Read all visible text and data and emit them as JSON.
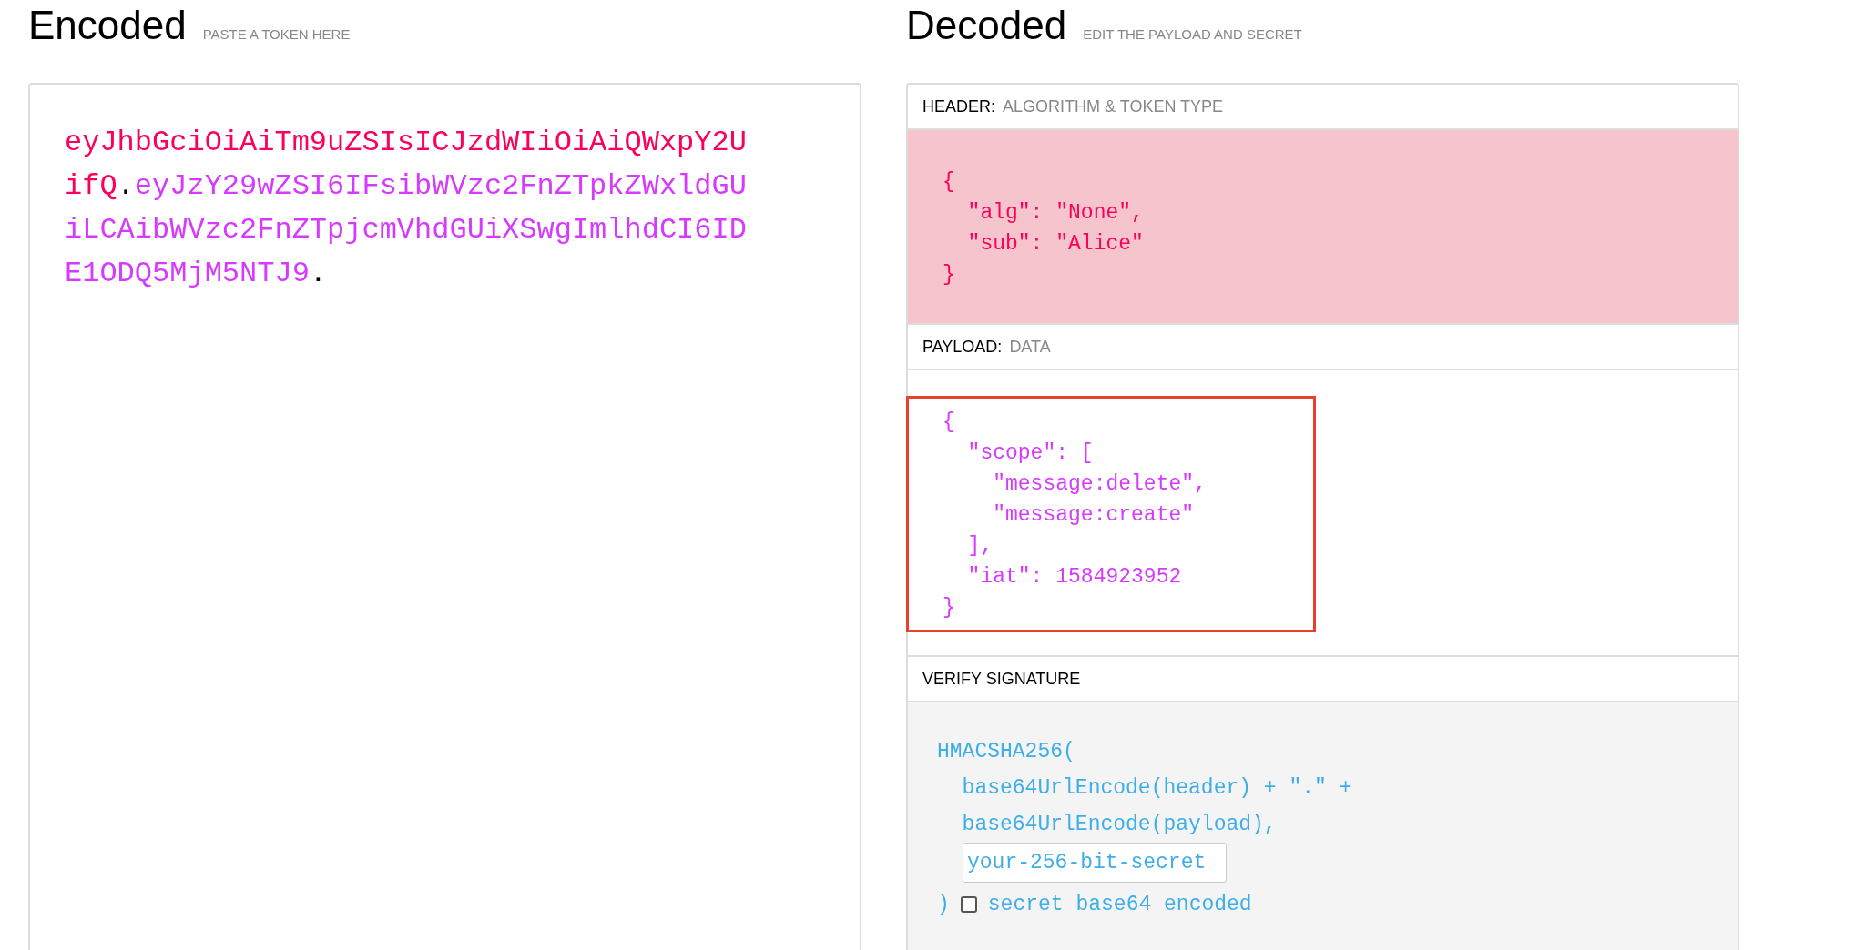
{
  "encoded": {
    "title": "Encoded",
    "subtitle": "PASTE A TOKEN HERE",
    "token": [
      {
        "kind": "header",
        "text": "eyJhbGciOiAiTm9uZSIsICJzdWIiOiAiQWxpY2UifQ"
      },
      {
        "kind": "dot",
        "text": "."
      },
      {
        "kind": "payload",
        "text": "eyJzY29wZSI6IFsibWVzc2FnZTpkZWxldGUiLCAibWVzc2FnZTpjcmVhdGUiXSwgImlhdCI6IDE1ODQ5MjM5NTJ9"
      },
      {
        "kind": "dot",
        "text": "."
      }
    ]
  },
  "decoded": {
    "title": "Decoded",
    "subtitle": "EDIT THE PAYLOAD AND SECRET",
    "sections": [
      {
        "kind": "header",
        "label": "HEADER:",
        "sublabel": "ALGORITHM & TOKEN TYPE",
        "lines": [
          "{",
          "  \"alg\": \"None\",",
          "  \"sub\": \"Alice\"",
          "}"
        ]
      },
      {
        "kind": "payload",
        "label": "PAYLOAD:",
        "sublabel": "DATA",
        "highlighted": true,
        "lines": [
          "{",
          "  \"scope\": [",
          "    \"message:delete\",",
          "    \"message:create\"",
          "  ],",
          "  \"iat\": 1584923952",
          "}"
        ]
      },
      {
        "kind": "verify",
        "label": "VERIFY SIGNATURE",
        "lines": [
          "HMACSHA256(",
          "  base64UrlEncode(header) + \".\" +",
          "  base64UrlEncode(payload),"
        ],
        "secret": {
          "value": "your-256-bit-secret"
        },
        "close": ")",
        "checkbox": {
          "label": "secret base64 encoded",
          "checked": false
        }
      }
    ]
  }
}
